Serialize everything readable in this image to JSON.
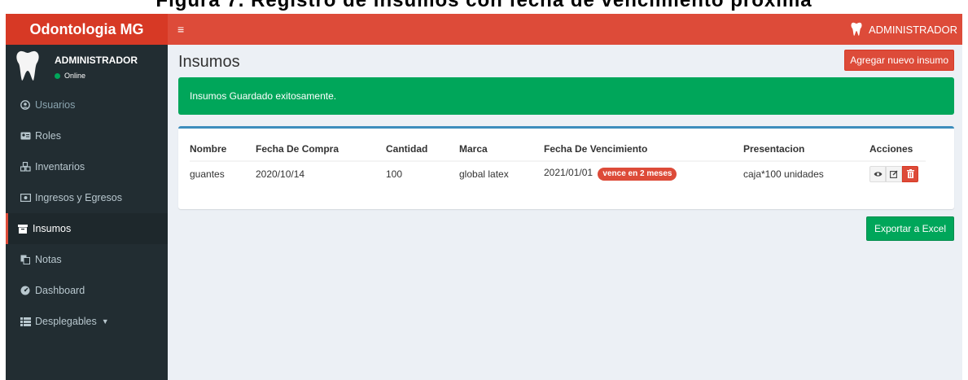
{
  "caption": "Figura 7. Registro de insumos con fecha de vencimiento próxima",
  "app": {
    "brand": "Odontologia MG",
    "menu_toggle": "≡",
    "user": "ADMINISTRADOR"
  },
  "sidebar": {
    "user_name": "ADMINISTRADOR",
    "user_status": "Online",
    "items": [
      {
        "label": "Usuarios",
        "icon": "user-circle-icon"
      },
      {
        "label": "Roles",
        "icon": "id-card-icon"
      },
      {
        "label": "Inventarios",
        "icon": "cubes-icon"
      },
      {
        "label": "Ingresos y Egresos",
        "icon": "money-icon"
      },
      {
        "label": "Insumos",
        "icon": "archive-icon"
      },
      {
        "label": "Notas",
        "icon": "copy-icon"
      },
      {
        "label": "Dashboard",
        "icon": "dashboard-icon"
      },
      {
        "label": "Desplegables",
        "icon": "list-icon"
      }
    ],
    "active_item": "Insumos"
  },
  "main": {
    "title": "Insumos",
    "add_button": "Agregar nuevo insumo",
    "alert": "Insumos Guardado exitosamente.",
    "table": {
      "headers": [
        "Nombre",
        "Fecha De Compra",
        "Cantidad",
        "Marca",
        "Fecha De Vencimiento",
        "Presentacion",
        "Acciones"
      ],
      "rows": [
        {
          "nombre": "guantes",
          "fecha_compra": "2020/10/14",
          "cantidad": "100",
          "marca": "global latex",
          "fecha_vencimiento": "2021/01/01",
          "badge": "vence en 2 meses",
          "presentacion": "caja*100 unidades",
          "actions": [
            "eye-icon",
            "edit-icon",
            "trash-icon"
          ]
        }
      ]
    },
    "export_button": "Exportar a Excel"
  },
  "colors": {
    "brand_dark": "#d73925",
    "brand": "#dd4b39",
    "sidebar": "#222d32",
    "success": "#00a65a",
    "box_border": "#3c8dbc"
  }
}
